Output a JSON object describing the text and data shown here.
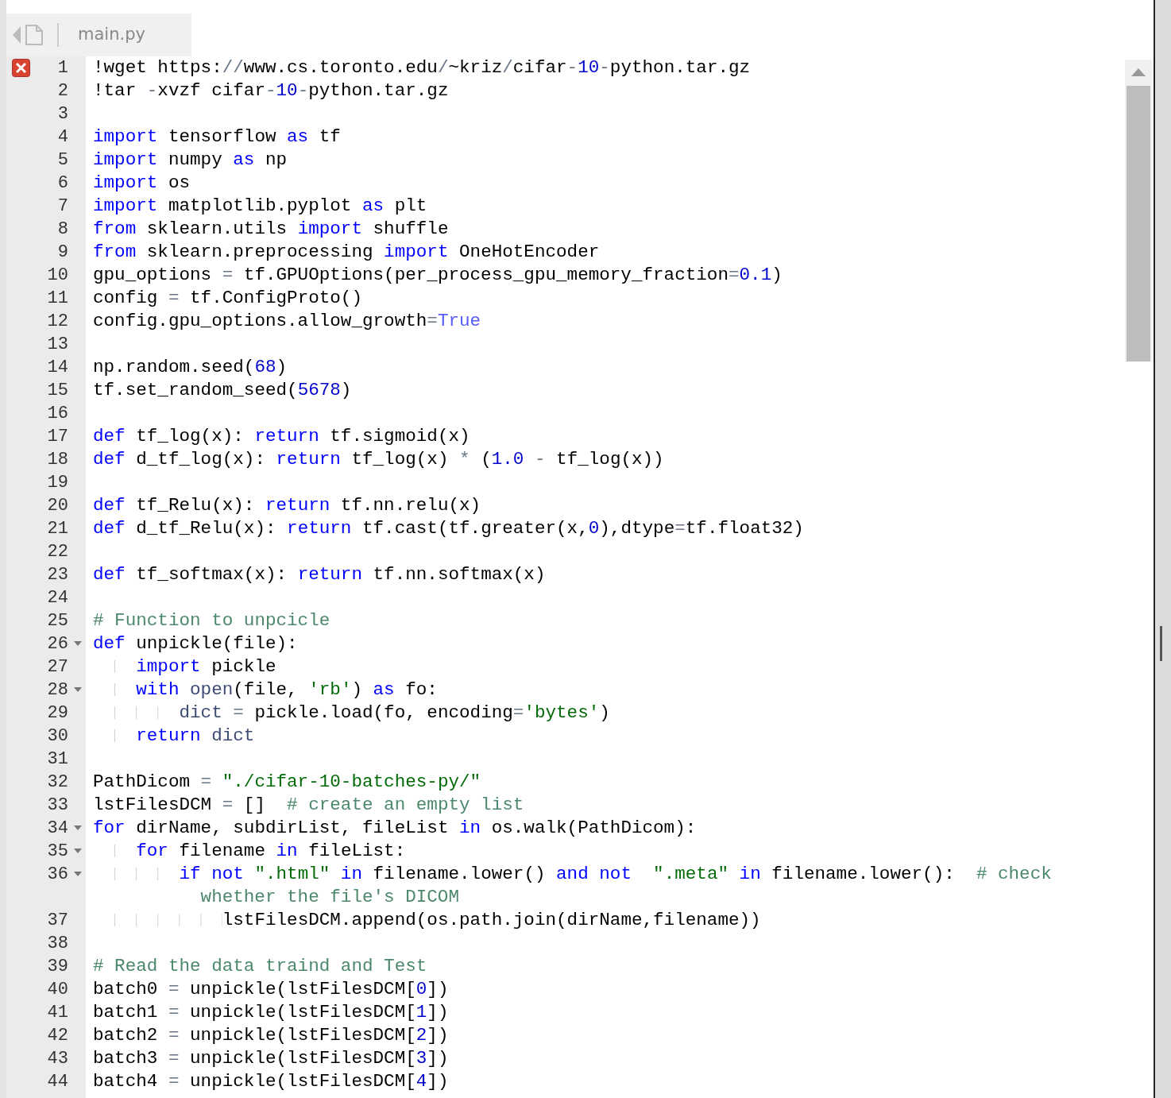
{
  "tab": {
    "label": "main.py"
  },
  "lines": [
    {
      "number": "1",
      "error": true,
      "fold": false,
      "tokens": [
        {
          "text": "!wget https:",
          "kind": "plain"
        },
        {
          "text": "//",
          "kind": "operator"
        },
        {
          "text": "www.cs.toronto.edu",
          "kind": "plain"
        },
        {
          "text": "/",
          "kind": "operator"
        },
        {
          "text": "~kriz",
          "kind": "plain"
        },
        {
          "text": "/",
          "kind": "operator"
        },
        {
          "text": "cifar",
          "kind": "plain"
        },
        {
          "text": "-",
          "kind": "operator"
        },
        {
          "text": "10",
          "kind": "number"
        },
        {
          "text": "-",
          "kind": "operator"
        },
        {
          "text": "python.tar.gz",
          "kind": "plain"
        }
      ]
    },
    {
      "number": "2",
      "error": false,
      "fold": false,
      "tokens": [
        {
          "text": "!tar ",
          "kind": "plain"
        },
        {
          "text": "-",
          "kind": "operator"
        },
        {
          "text": "xvzf cifar",
          "kind": "plain"
        },
        {
          "text": "-",
          "kind": "operator"
        },
        {
          "text": "10",
          "kind": "number"
        },
        {
          "text": "-",
          "kind": "operator"
        },
        {
          "text": "python.tar.gz",
          "kind": "plain"
        }
      ]
    },
    {
      "number": "3",
      "error": false,
      "fold": false
    },
    {
      "number": "4",
      "error": false,
      "fold": false,
      "tokens": [
        {
          "text": "import",
          "kind": "keyword"
        },
        {
          "text": " tensorflow ",
          "kind": "plain"
        },
        {
          "text": "as",
          "kind": "keyword"
        },
        {
          "text": " tf",
          "kind": "plain"
        }
      ]
    },
    {
      "number": "5",
      "error": false,
      "fold": false,
      "tokens": [
        {
          "text": "import",
          "kind": "keyword"
        },
        {
          "text": " numpy ",
          "kind": "plain"
        },
        {
          "text": "as",
          "kind": "keyword"
        },
        {
          "text": " np",
          "kind": "plain"
        }
      ]
    },
    {
      "number": "6",
      "error": false,
      "fold": false,
      "tokens": [
        {
          "text": "import",
          "kind": "keyword"
        },
        {
          "text": " os",
          "kind": "plain"
        }
      ]
    },
    {
      "number": "7",
      "error": false,
      "fold": false,
      "tokens": [
        {
          "text": "import",
          "kind": "keyword"
        },
        {
          "text": " matplotlib.pyplot ",
          "kind": "plain"
        },
        {
          "text": "as",
          "kind": "keyword"
        },
        {
          "text": " plt",
          "kind": "plain"
        }
      ]
    },
    {
      "number": "8",
      "error": false,
      "fold": false,
      "tokens": [
        {
          "text": "from",
          "kind": "keyword"
        },
        {
          "text": " sklearn.utils ",
          "kind": "plain"
        },
        {
          "text": "import",
          "kind": "keyword"
        },
        {
          "text": " shuffle",
          "kind": "plain"
        }
      ]
    },
    {
      "number": "9",
      "error": false,
      "fold": false,
      "tokens": [
        {
          "text": "from",
          "kind": "keyword"
        },
        {
          "text": " sklearn.preprocessing ",
          "kind": "plain"
        },
        {
          "text": "import",
          "kind": "keyword"
        },
        {
          "text": " OneHotEncoder",
          "kind": "plain"
        }
      ]
    },
    {
      "number": "10",
      "error": false,
      "fold": false,
      "tokens": [
        {
          "text": "gpu_options ",
          "kind": "plain"
        },
        {
          "text": "=",
          "kind": "operator"
        },
        {
          "text": " tf.GPUOptions(per_process_gpu_memory_fraction",
          "kind": "plain"
        },
        {
          "text": "=",
          "kind": "operator"
        },
        {
          "text": "0.1",
          "kind": "number"
        },
        {
          "text": ")",
          "kind": "plain"
        }
      ]
    },
    {
      "number": "11",
      "error": false,
      "fold": false,
      "tokens": [
        {
          "text": "config ",
          "kind": "plain"
        },
        {
          "text": "=",
          "kind": "operator"
        },
        {
          "text": " tf.ConfigProto()",
          "kind": "plain"
        }
      ]
    },
    {
      "number": "12",
      "error": false,
      "fold": false,
      "tokens": [
        {
          "text": "config.gpu_options.allow_growth",
          "kind": "plain"
        },
        {
          "text": "=",
          "kind": "operator"
        },
        {
          "text": "True",
          "kind": "constant"
        }
      ]
    },
    {
      "number": "13",
      "error": false,
      "fold": false
    },
    {
      "number": "14",
      "error": false,
      "fold": false,
      "tokens": [
        {
          "text": "np.random.seed(",
          "kind": "plain"
        },
        {
          "text": "68",
          "kind": "number"
        },
        {
          "text": ")",
          "kind": "plain"
        }
      ]
    },
    {
      "number": "15",
      "error": false,
      "fold": false,
      "tokens": [
        {
          "text": "tf.set_random_seed(",
          "kind": "plain"
        },
        {
          "text": "5678",
          "kind": "number"
        },
        {
          "text": ")",
          "kind": "plain"
        }
      ]
    },
    {
      "number": "16",
      "error": false,
      "fold": false
    },
    {
      "number": "17",
      "error": false,
      "fold": false,
      "tokens": [
        {
          "text": "def",
          "kind": "keyword"
        },
        {
          "text": " tf_log(x): ",
          "kind": "plain"
        },
        {
          "text": "return",
          "kind": "keyword"
        },
        {
          "text": " tf.sigmoid(x)",
          "kind": "plain"
        }
      ]
    },
    {
      "number": "18",
      "error": false,
      "fold": false,
      "tokens": [
        {
          "text": "def",
          "kind": "keyword"
        },
        {
          "text": " d_tf_log(x): ",
          "kind": "plain"
        },
        {
          "text": "return",
          "kind": "keyword"
        },
        {
          "text": " tf_log(x) ",
          "kind": "plain"
        },
        {
          "text": "*",
          "kind": "operator"
        },
        {
          "text": " (",
          "kind": "plain"
        },
        {
          "text": "1.0",
          "kind": "number"
        },
        {
          "text": " -",
          "kind": "operator"
        },
        {
          "text": " tf_log(x))",
          "kind": "plain"
        }
      ]
    },
    {
      "number": "19",
      "error": false,
      "fold": false
    },
    {
      "number": "20",
      "error": false,
      "fold": false,
      "tokens": [
        {
          "text": "def",
          "kind": "keyword"
        },
        {
          "text": " tf_Relu(x): ",
          "kind": "plain"
        },
        {
          "text": "return",
          "kind": "keyword"
        },
        {
          "text": " tf.nn.relu(x)",
          "kind": "plain"
        }
      ]
    },
    {
      "number": "21",
      "error": false,
      "fold": false,
      "tokens": [
        {
          "text": "def",
          "kind": "keyword"
        },
        {
          "text": " d_tf_Relu(x): ",
          "kind": "plain"
        },
        {
          "text": "return",
          "kind": "keyword"
        },
        {
          "text": " tf.cast(tf.greater(x,",
          "kind": "plain"
        },
        {
          "text": "0",
          "kind": "number"
        },
        {
          "text": "),dtype",
          "kind": "plain"
        },
        {
          "text": "=",
          "kind": "operator"
        },
        {
          "text": "tf.float32)",
          "kind": "plain"
        }
      ]
    },
    {
      "number": "22",
      "error": false,
      "fold": false
    },
    {
      "number": "23",
      "error": false,
      "fold": false,
      "tokens": [
        {
          "text": "def",
          "kind": "keyword"
        },
        {
          "text": " tf_softmax(x): ",
          "kind": "plain"
        },
        {
          "text": "return",
          "kind": "keyword"
        },
        {
          "text": " tf.nn.softmax(x)",
          "kind": "plain"
        }
      ]
    },
    {
      "number": "24",
      "error": false,
      "fold": false
    },
    {
      "number": "25",
      "error": false,
      "fold": false,
      "tokens": [
        {
          "text": "# Function to unpcicle",
          "kind": "comment"
        }
      ]
    },
    {
      "number": "26",
      "error": false,
      "fold": true,
      "tokens": [
        {
          "text": "def",
          "kind": "keyword"
        },
        {
          "text": " unpickle(file):",
          "kind": "plain"
        }
      ]
    },
    {
      "number": "27",
      "error": false,
      "fold": false,
      "tokens": [
        {
          "text": "    import",
          "kind": "keyword"
        },
        {
          "text": " pickle",
          "kind": "plain"
        }
      ]
    },
    {
      "number": "28",
      "error": false,
      "fold": true,
      "tokens": [
        {
          "text": "    with",
          "kind": "keyword"
        },
        {
          "text": " open",
          "kind": "builtin"
        },
        {
          "text": "(file, ",
          "kind": "plain"
        },
        {
          "text": "'rb'",
          "kind": "string"
        },
        {
          "text": ") ",
          "kind": "plain"
        },
        {
          "text": "as",
          "kind": "keyword"
        },
        {
          "text": " fo:",
          "kind": "plain"
        }
      ]
    },
    {
      "number": "29",
      "error": false,
      "fold": false,
      "tokens": [
        {
          "text": "        dict",
          "kind": "builtin"
        },
        {
          "text": " =",
          "kind": "operator"
        },
        {
          "text": " pickle.load(fo, encoding",
          "kind": "plain"
        },
        {
          "text": "=",
          "kind": "operator"
        },
        {
          "text": "'bytes'",
          "kind": "string"
        },
        {
          "text": ")",
          "kind": "plain"
        }
      ]
    },
    {
      "number": "30",
      "error": false,
      "fold": false,
      "tokens": [
        {
          "text": "    return",
          "kind": "keyword"
        },
        {
          "text": " dict",
          "kind": "builtin"
        }
      ]
    },
    {
      "number": "31",
      "error": false,
      "fold": false
    },
    {
      "number": "32",
      "error": false,
      "fold": false,
      "tokens": [
        {
          "text": "PathDicom ",
          "kind": "plain"
        },
        {
          "text": "=",
          "kind": "operator"
        },
        {
          "text": " \"./cifar-10-batches-py/\"",
          "kind": "string"
        }
      ]
    },
    {
      "number": "33",
      "error": false,
      "fold": false,
      "tokens": [
        {
          "text": "lstFilesDCM ",
          "kind": "plain"
        },
        {
          "text": "=",
          "kind": "operator"
        },
        {
          "text": " []  ",
          "kind": "plain"
        },
        {
          "text": "# create an empty list",
          "kind": "comment"
        }
      ]
    },
    {
      "number": "34",
      "error": false,
      "fold": true,
      "tokens": [
        {
          "text": "for",
          "kind": "keyword"
        },
        {
          "text": " dirName, subdirList, fileList ",
          "kind": "plain"
        },
        {
          "text": "in",
          "kind": "keyword"
        },
        {
          "text": " os.walk(PathDicom):",
          "kind": "plain"
        }
      ]
    },
    {
      "number": "35",
      "error": false,
      "fold": true,
      "tokens": [
        {
          "text": "    for",
          "kind": "keyword"
        },
        {
          "text": " filename ",
          "kind": "plain"
        },
        {
          "text": "in",
          "kind": "keyword"
        },
        {
          "text": " fileList:",
          "kind": "plain"
        }
      ]
    },
    {
      "number": "36",
      "error": false,
      "fold": true,
      "tokens": [
        {
          "text": "        if",
          "kind": "keyword"
        },
        {
          "text": " not",
          "kind": "keyword"
        },
        {
          "text": " \".html\"",
          "kind": "string"
        },
        {
          "text": " in",
          "kind": "keyword"
        },
        {
          "text": " filename.lower() ",
          "kind": "plain"
        },
        {
          "text": "and",
          "kind": "keyword"
        },
        {
          "text": " not",
          "kind": "keyword"
        },
        {
          "text": "  \".meta\"",
          "kind": "string"
        },
        {
          "text": " in",
          "kind": "keyword"
        },
        {
          "text": " filename.lower():  ",
          "kind": "plain"
        },
        {
          "text": "# check",
          "kind": "comment"
        }
      ],
      "wrap_tokens": [
        {
          "text": "whether the file's DICOM",
          "kind": "comment"
        }
      ]
    },
    {
      "number": "37",
      "error": false,
      "fold": false,
      "tokens": [
        {
          "text": "            lstFilesDCM.append(os.path.join(dirName,filename))",
          "kind": "plain"
        }
      ]
    },
    {
      "number": "38",
      "error": false,
      "fold": false
    },
    {
      "number": "39",
      "error": false,
      "fold": false,
      "tokens": [
        {
          "text": "# Read the data traind and Test",
          "kind": "comment"
        }
      ]
    },
    {
      "number": "40",
      "error": false,
      "fold": false,
      "tokens": [
        {
          "text": "batch0 ",
          "kind": "plain"
        },
        {
          "text": "=",
          "kind": "operator"
        },
        {
          "text": " unpickle(lstFilesDCM[",
          "kind": "plain"
        },
        {
          "text": "0",
          "kind": "number"
        },
        {
          "text": "])",
          "kind": "plain"
        }
      ]
    },
    {
      "number": "41",
      "error": false,
      "fold": false,
      "tokens": [
        {
          "text": "batch1 ",
          "kind": "plain"
        },
        {
          "text": "=",
          "kind": "operator"
        },
        {
          "text": " unpickle(lstFilesDCM[",
          "kind": "plain"
        },
        {
          "text": "1",
          "kind": "number"
        },
        {
          "text": "])",
          "kind": "plain"
        }
      ]
    },
    {
      "number": "42",
      "error": false,
      "fold": false,
      "tokens": [
        {
          "text": "batch2 ",
          "kind": "plain"
        },
        {
          "text": "=",
          "kind": "operator"
        },
        {
          "text": " unpickle(lstFilesDCM[",
          "kind": "plain"
        },
        {
          "text": "2",
          "kind": "number"
        },
        {
          "text": "])",
          "kind": "plain"
        }
      ]
    },
    {
      "number": "43",
      "error": false,
      "fold": false,
      "tokens": [
        {
          "text": "batch3 ",
          "kind": "plain"
        },
        {
          "text": "=",
          "kind": "operator"
        },
        {
          "text": " unpickle(lstFilesDCM[",
          "kind": "plain"
        },
        {
          "text": "3",
          "kind": "number"
        },
        {
          "text": "])",
          "kind": "plain"
        }
      ]
    },
    {
      "number": "44",
      "error": false,
      "fold": false,
      "tokens": [
        {
          "text": "batch4 ",
          "kind": "plain"
        },
        {
          "text": "=",
          "kind": "operator"
        },
        {
          "text": " unpickle(lstFilesDCM[",
          "kind": "plain"
        },
        {
          "text": "4",
          "kind": "number"
        },
        {
          "text": "])",
          "kind": "plain"
        }
      ]
    }
  ]
}
